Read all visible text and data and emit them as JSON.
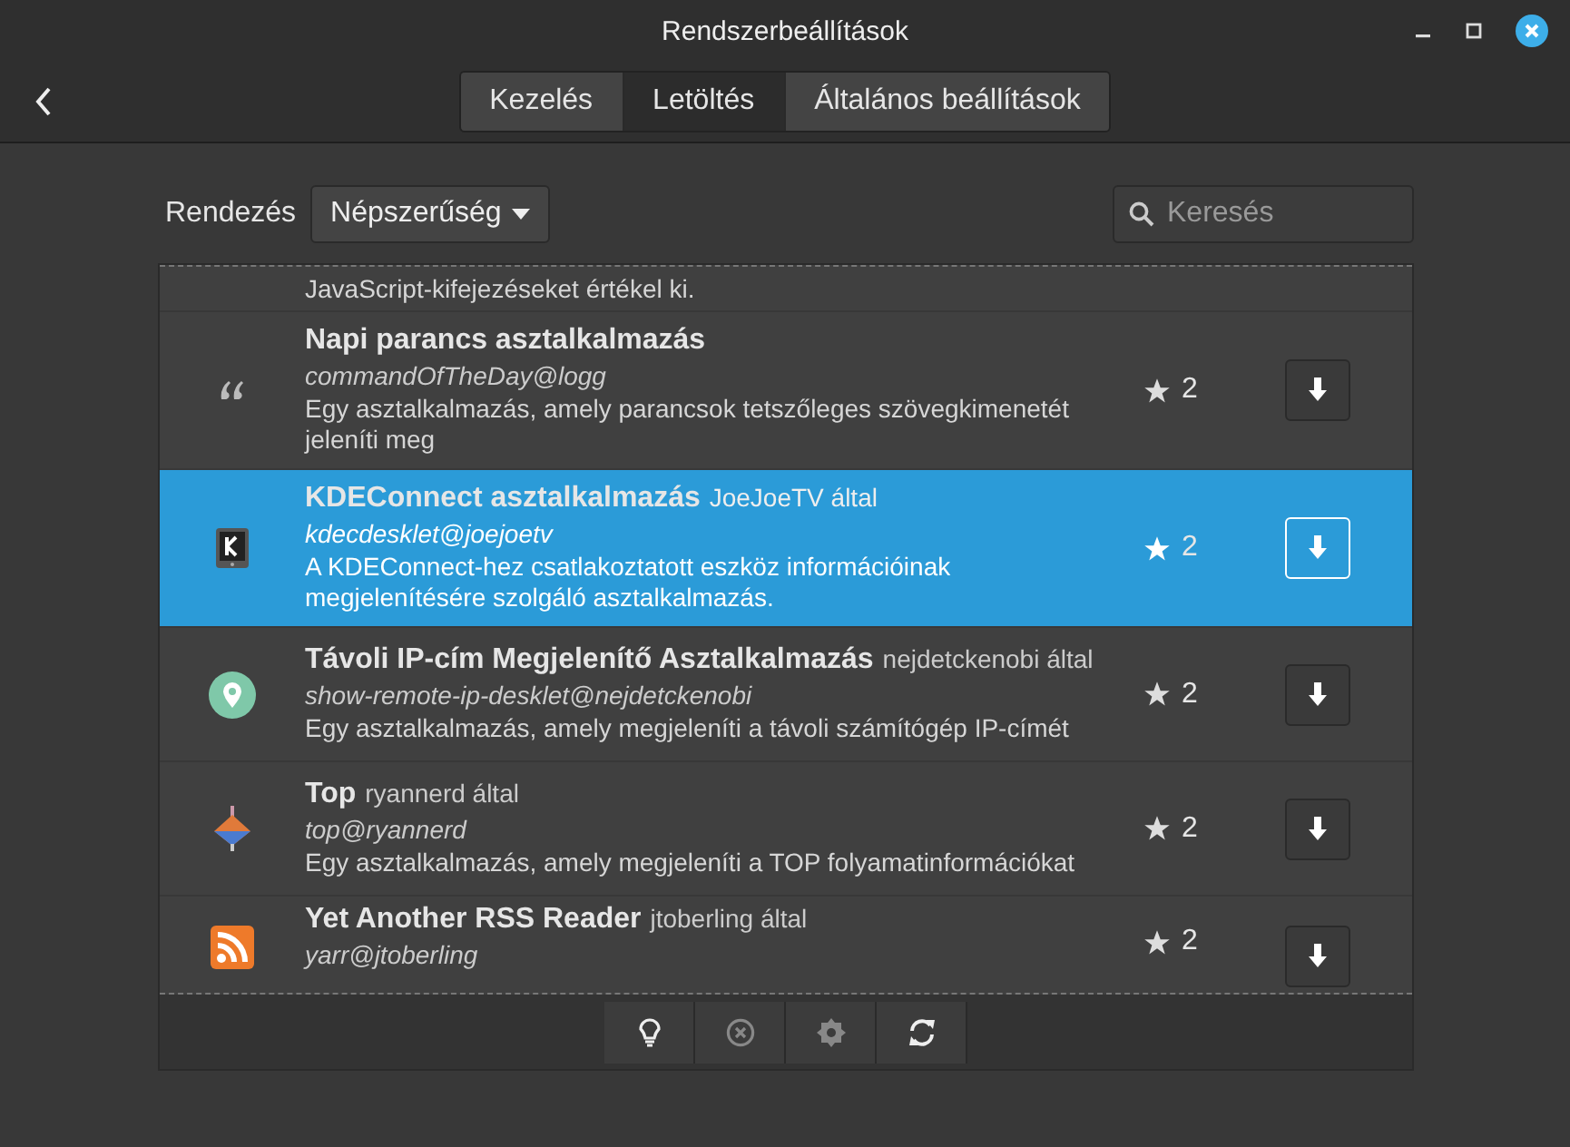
{
  "window": {
    "title": "Rendszerbeállítások"
  },
  "tabs": [
    {
      "label": "Kezelés",
      "selected": false
    },
    {
      "label": "Letöltés",
      "selected": true
    },
    {
      "label": "Általános beállítások",
      "selected": false
    }
  ],
  "sort": {
    "label": "Rendezés",
    "value": "Népszerűség"
  },
  "search": {
    "placeholder": "Keresés"
  },
  "partial_row": {
    "description": "JavaScript-kifejezéseket értékel ki."
  },
  "rows": [
    {
      "title": "Napi parancs asztalkalmazás",
      "uuid": "commandOfTheDay@logg",
      "description": "Egy asztalkalmazás, amely parancsok tetszőleges szövegkimenetét jeleníti meg",
      "score": "2",
      "selected": false
    },
    {
      "title": "KDEConnect asztalkalmazás",
      "author": "JoeJoeTV által",
      "uuid": "kdecdesklet@joejoetv",
      "description": "A KDEConnect-hez csatlakoztatott eszköz információinak megjelenítésére szolgáló asztalkalmazás.",
      "score": "2",
      "selected": true
    },
    {
      "title": "Távoli IP-cím Megjelenítő Asztalkalmazás",
      "author": "nejdetckenobi által",
      "uuid": "show-remote-ip-desklet@nejdetckenobi",
      "description": "Egy asztalkalmazás, amely megjeleníti a távoli számítógép IP-címét",
      "score": "2",
      "selected": false
    },
    {
      "title": "Top",
      "author": "ryannerd által",
      "uuid": "top@ryannerd",
      "description": "Egy asztalkalmazás, amely megjeleníti a TOP folyamatinformációkat",
      "score": "2",
      "selected": false
    },
    {
      "title": "Yet Another RSS Reader",
      "author": "jtoberling által",
      "uuid": "yarr@jtoberling",
      "score": "2",
      "selected": false
    }
  ],
  "toolbar": [
    {
      "disabled": false
    },
    {
      "disabled": true
    },
    {
      "disabled": true
    },
    {
      "disabled": false
    }
  ]
}
